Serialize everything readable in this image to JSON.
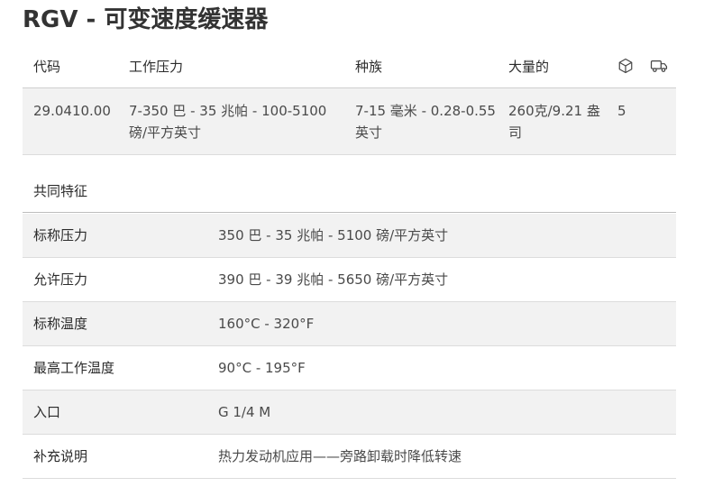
{
  "title": {
    "code": "RGV",
    "separator": " - ",
    "name": "可变速度缓速器"
  },
  "product_table": {
    "headers": {
      "code": "代码",
      "working_pressure": "工作压力",
      "range": "种族",
      "weight": "大量的",
      "package_icon": "box-icon",
      "shipping_icon": "truck-icon"
    },
    "rows": [
      {
        "code": "29.0410.00",
        "working_pressure": "7-350 巴 - 35 兆帕 - 100-5100 磅/平方英寸",
        "range": "7-15 毫米 - 0.28-0.55 英寸",
        "weight": "260克/9.21 盎司",
        "qty": "5",
        "shipping": ""
      }
    ]
  },
  "features": {
    "title": "共同特征",
    "rows": [
      {
        "label": "标称压力",
        "value": "350 巴 - 35 兆帕 - 5100 磅/平方英寸"
      },
      {
        "label": "允许压力",
        "value": "390 巴 - 39 兆帕 - 5650 磅/平方英寸"
      },
      {
        "label": "标称温度",
        "value": "160°C - 320°F"
      },
      {
        "label": "最高工作温度",
        "value": "90°C - 195°F"
      },
      {
        "label": "入口",
        "value": "G 1/4 M"
      },
      {
        "label": "补充说明",
        "value": "热力发动机应用——旁路卸载时降低转速"
      }
    ]
  },
  "colors": {
    "row_alt": "#f2f2f2",
    "border": "#dcdcdc",
    "text": "#2b2b2b"
  }
}
